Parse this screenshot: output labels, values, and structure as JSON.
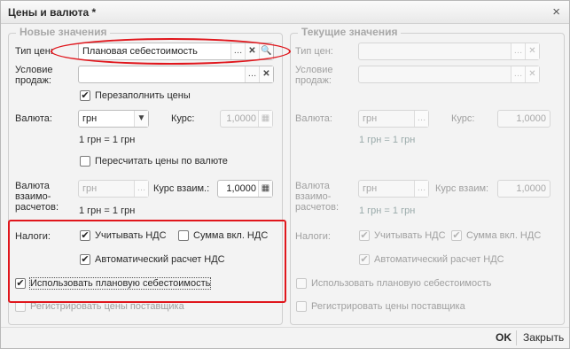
{
  "window": {
    "title": "Цены и валюта *",
    "close_glyph": "×"
  },
  "left": {
    "group_title": "Новые значения",
    "price_type_label": "Тип цен:",
    "price_type_value": "Плановая себестоимость",
    "sale_condition_label": "Условие продаж:",
    "sale_condition_value": "",
    "refill_prices_label": "Перезаполнить цены",
    "refill_prices_checked": true,
    "currency_label": "Валюта:",
    "currency_value": "грн",
    "rate_label": "Курс:",
    "rate_value": "1,0000",
    "rate_text": "1 грн = 1 грн",
    "recalc_label": "Пересчитать цены по валюте",
    "recalc_checked": false,
    "settle_currency_label": "Валюта взаимо-расчетов:",
    "settle_currency_value": "грн",
    "settle_rate_label": "Курс взаим.:",
    "settle_rate_value": "1,0000",
    "settle_rate_text": "1 грн = 1 грн",
    "taxes_label": "Налоги:",
    "vat_label": "Учитывать НДС",
    "vat_checked": true,
    "vat_incl_label": "Сумма вкл. НДС",
    "vat_incl_checked": false,
    "auto_vat_label": "Автоматический расчет НДС",
    "auto_vat_checked": true,
    "planned_cost_label": "Использовать плановую себестоимость",
    "planned_cost_checked": true,
    "register_supplier_label": "Регистрировать цены поставщика",
    "register_supplier_checked": false
  },
  "right": {
    "group_title": "Текущие значения",
    "price_type_label": "Тип цен:",
    "sale_condition_label": "Условие продаж:",
    "currency_label": "Валюта:",
    "currency_value": "грн",
    "rate_label": "Курс:",
    "rate_value": "1,0000",
    "rate_text": "1 грн = 1 грн",
    "settle_currency_label": "Валюта взаимо-расчетов:",
    "settle_currency_value": "грн",
    "settle_rate_label": "Курс взаим:",
    "settle_rate_value": "1,0000",
    "settle_rate_text": "1 грн = 1 грн",
    "taxes_label": "Налоги:",
    "vat_label": "Учитывать НДС",
    "vat_incl_label": "Сумма вкл. НДС",
    "auto_vat_label": "Автоматический расчет НДС",
    "planned_cost_label": "Использовать плановую себестоимость",
    "register_supplier_label": "Регистрировать цены поставщика"
  },
  "footer": {
    "ok_label": "OK",
    "close_label": "Закрыть"
  },
  "colors": {
    "highlight": "#e0161c"
  }
}
